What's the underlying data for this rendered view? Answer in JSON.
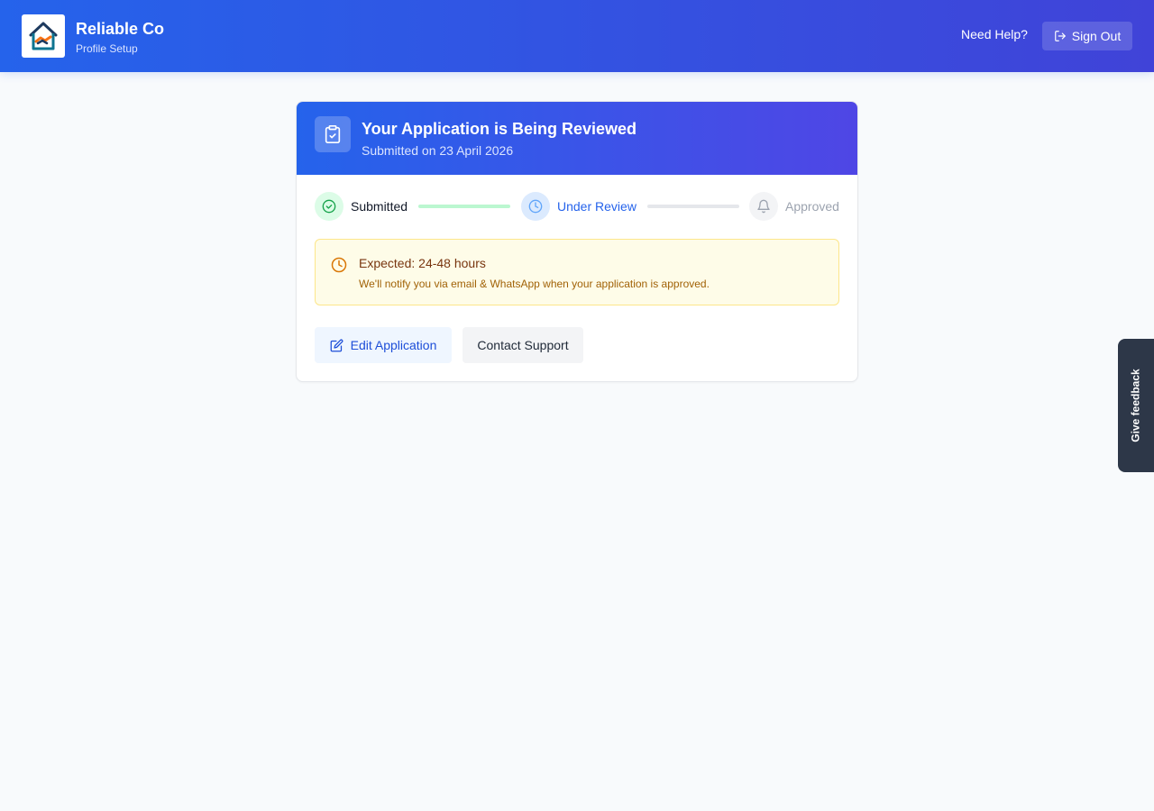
{
  "header": {
    "brand_name": "Reliable Co",
    "brand_subtitle": "Profile Setup",
    "logo_icon": "house-handshake-logo",
    "need_help_label": "Need Help?",
    "sign_out_label": "Sign Out",
    "sign_out_icon": "sign-out-icon"
  },
  "card": {
    "title": "Your Application is Being Reviewed",
    "subtitle": "Submitted on 23 April 2026",
    "header_icon": "clipboard-check-icon",
    "steps": [
      {
        "label": "Submitted",
        "state": "complete",
        "icon": "check-circle-icon"
      },
      {
        "label": "Under Review",
        "state": "current",
        "icon": "clock-icon"
      },
      {
        "label": "Approved",
        "state": "pending",
        "icon": "bell-icon"
      }
    ],
    "notice": {
      "icon": "clock-icon",
      "title": "Expected: 24-48 hours",
      "text": "We'll notify you via email & WhatsApp when your application is approved."
    },
    "edit_button_label": "Edit Application",
    "edit_button_icon": "edit-icon",
    "support_button_label": "Contact Support"
  },
  "feedback_tab": {
    "label": "Give feedback"
  },
  "colors": {
    "header_gradient_start": "#2563eb",
    "header_gradient_end": "#4043d8",
    "step_complete": "#16a34a",
    "step_current": "#2563eb",
    "step_pending": "#9ca3af",
    "notice_bg": "#fefce8",
    "notice_border": "#fde68a",
    "feedback_bg": "#2d3748"
  }
}
